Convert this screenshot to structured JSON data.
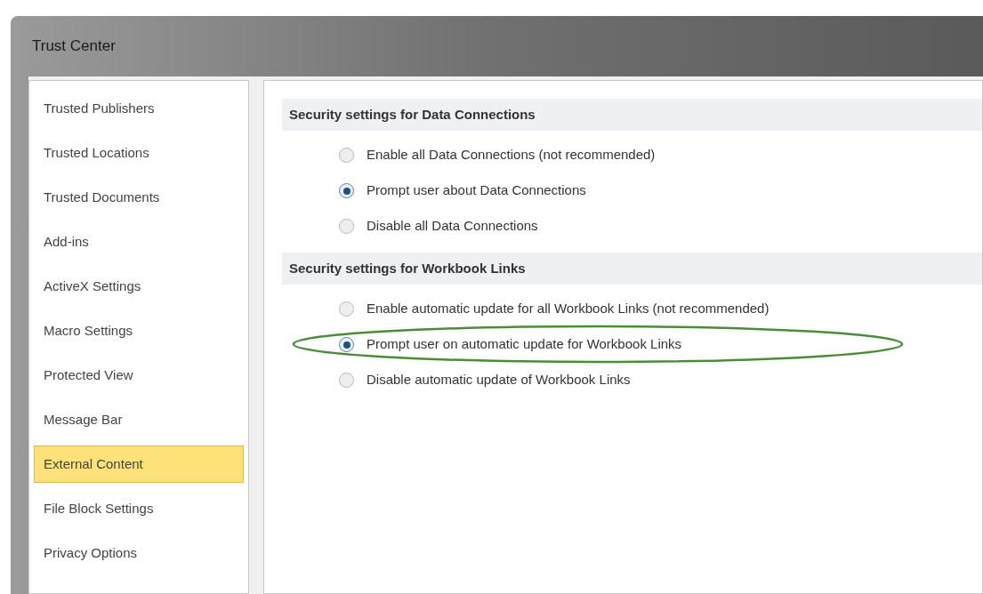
{
  "window": {
    "title": "Trust Center"
  },
  "sidebar": {
    "items": [
      {
        "label": "Trusted Publishers",
        "selected": false
      },
      {
        "label": "Trusted Locations",
        "selected": false
      },
      {
        "label": "Trusted Documents",
        "selected": false
      },
      {
        "label": "Add-ins",
        "selected": false
      },
      {
        "label": "ActiveX Settings",
        "selected": false
      },
      {
        "label": "Macro Settings",
        "selected": false
      },
      {
        "label": "Protected View",
        "selected": false
      },
      {
        "label": "Message Bar",
        "selected": false
      },
      {
        "label": "External Content",
        "selected": true
      },
      {
        "label": "File Block Settings",
        "selected": false
      },
      {
        "label": "Privacy Options",
        "selected": false
      }
    ]
  },
  "sections": [
    {
      "title": "Security settings for Data Connections",
      "options": [
        {
          "label": "Enable all Data Connections (not recommended)",
          "selected": false,
          "highlighted": false
        },
        {
          "label": "Prompt user about Data Connections",
          "selected": true,
          "highlighted": false
        },
        {
          "label": "Disable all Data Connections",
          "selected": false,
          "highlighted": false
        }
      ]
    },
    {
      "title": "Security settings for Workbook Links",
      "options": [
        {
          "label": "Enable automatic update for all Workbook Links (not recommended)",
          "selected": false,
          "highlighted": false
        },
        {
          "label": "Prompt user on automatic update for Workbook Links",
          "selected": true,
          "highlighted": true
        },
        {
          "label": "Disable automatic update of Workbook Links",
          "selected": false,
          "highlighted": false
        }
      ]
    }
  ]
}
